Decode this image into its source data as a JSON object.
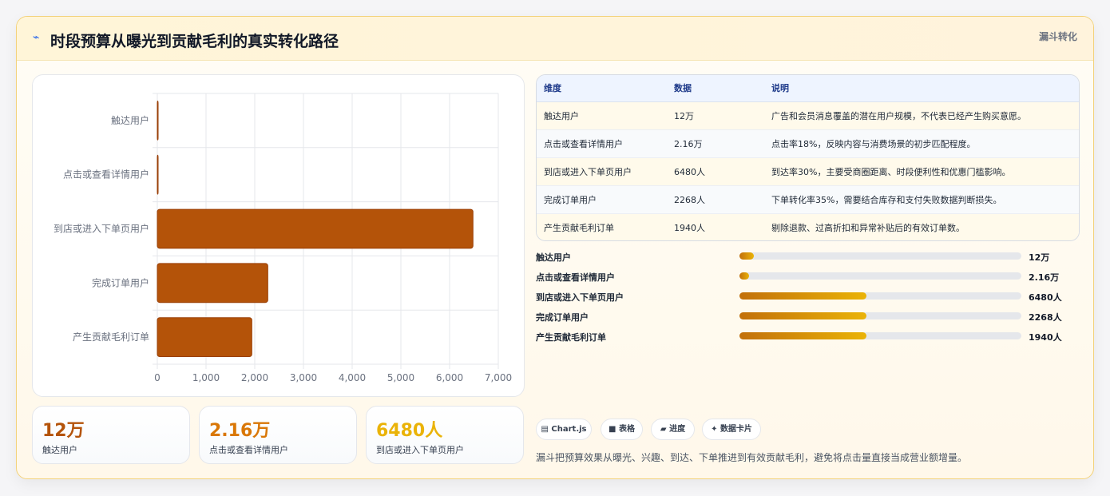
{
  "header": {
    "title": "时段预算从曝光到贡献毛利的真实转化路径",
    "badge": "漏斗转化",
    "icon": "pulse-icon"
  },
  "chart_data": {
    "type": "bar",
    "orientation": "horizontal",
    "categories": [
      "触达用户",
      "点击或查看详情用户",
      "到店或进入下单页用户",
      "完成订单用户",
      "产生贡献毛利订单"
    ],
    "values": [
      12,
      2.16,
      6480,
      2268,
      1940
    ],
    "xlim": [
      0,
      7000
    ],
    "xticks": [
      "0",
      "1,000",
      "2,000",
      "3,000",
      "4,000",
      "5,000",
      "6,000",
      "7,000"
    ],
    "bar_color": "#b45309",
    "grid": true
  },
  "stats": [
    {
      "value": "12万",
      "label": "触达用户",
      "color": "#b45309"
    },
    {
      "value": "2.16万",
      "label": "点击或查看详情用户",
      "color": "#d97706"
    },
    {
      "value": "6480人",
      "label": "到店或进入下单页用户",
      "color": "#eab308"
    }
  ],
  "table": {
    "headers": [
      "维度",
      "数据",
      "说明"
    ],
    "rows": [
      [
        "触达用户",
        "12万",
        "广告和会员消息覆盖的潜在用户规模，不代表已经产生购买意愿。"
      ],
      [
        "点击或查看详情用户",
        "2.16万",
        "点击率18%，反映内容与消费场景的初步匹配程度。"
      ],
      [
        "到店或进入下单页用户",
        "6480人",
        "到达率30%，主要受商圈距离、时段便利性和优惠门槛影响。"
      ],
      [
        "完成订单用户",
        "2268人",
        "下单转化率35%，需要结合库存和支付失败数据判断损失。"
      ],
      [
        "产生贡献毛利订单",
        "1940人",
        "剔除退款、过高折扣和异常补贴后的有效订单数。"
      ]
    ]
  },
  "progress": [
    {
      "label": "触达用户",
      "value": "12万",
      "fraction": 0.05
    },
    {
      "label": "点击或查看详情用户",
      "value": "2.16万",
      "fraction": 0.035
    },
    {
      "label": "到店或进入下单页用户",
      "value": "6480人",
      "fraction": 0.45
    },
    {
      "label": "完成订单用户",
      "value": "2268人",
      "fraction": 0.45
    },
    {
      "label": "产生贡献毛利订单",
      "value": "1940人",
      "fraction": 0.45
    }
  ],
  "chips": [
    {
      "icon": "chart-icon",
      "glyph": "▤",
      "label": "Chart.js"
    },
    {
      "icon": "table-icon",
      "glyph": "■",
      "label": "表格"
    },
    {
      "icon": "progress-icon",
      "glyph": "▰",
      "label": "进度"
    },
    {
      "icon": "card-icon",
      "glyph": "✦",
      "label": "数据卡片"
    }
  ],
  "footnote": "漏斗把预算效果从曝光、兴趣、到达、下单推进到有效贡献毛利，避免将点击量直接当成营业额增量。"
}
